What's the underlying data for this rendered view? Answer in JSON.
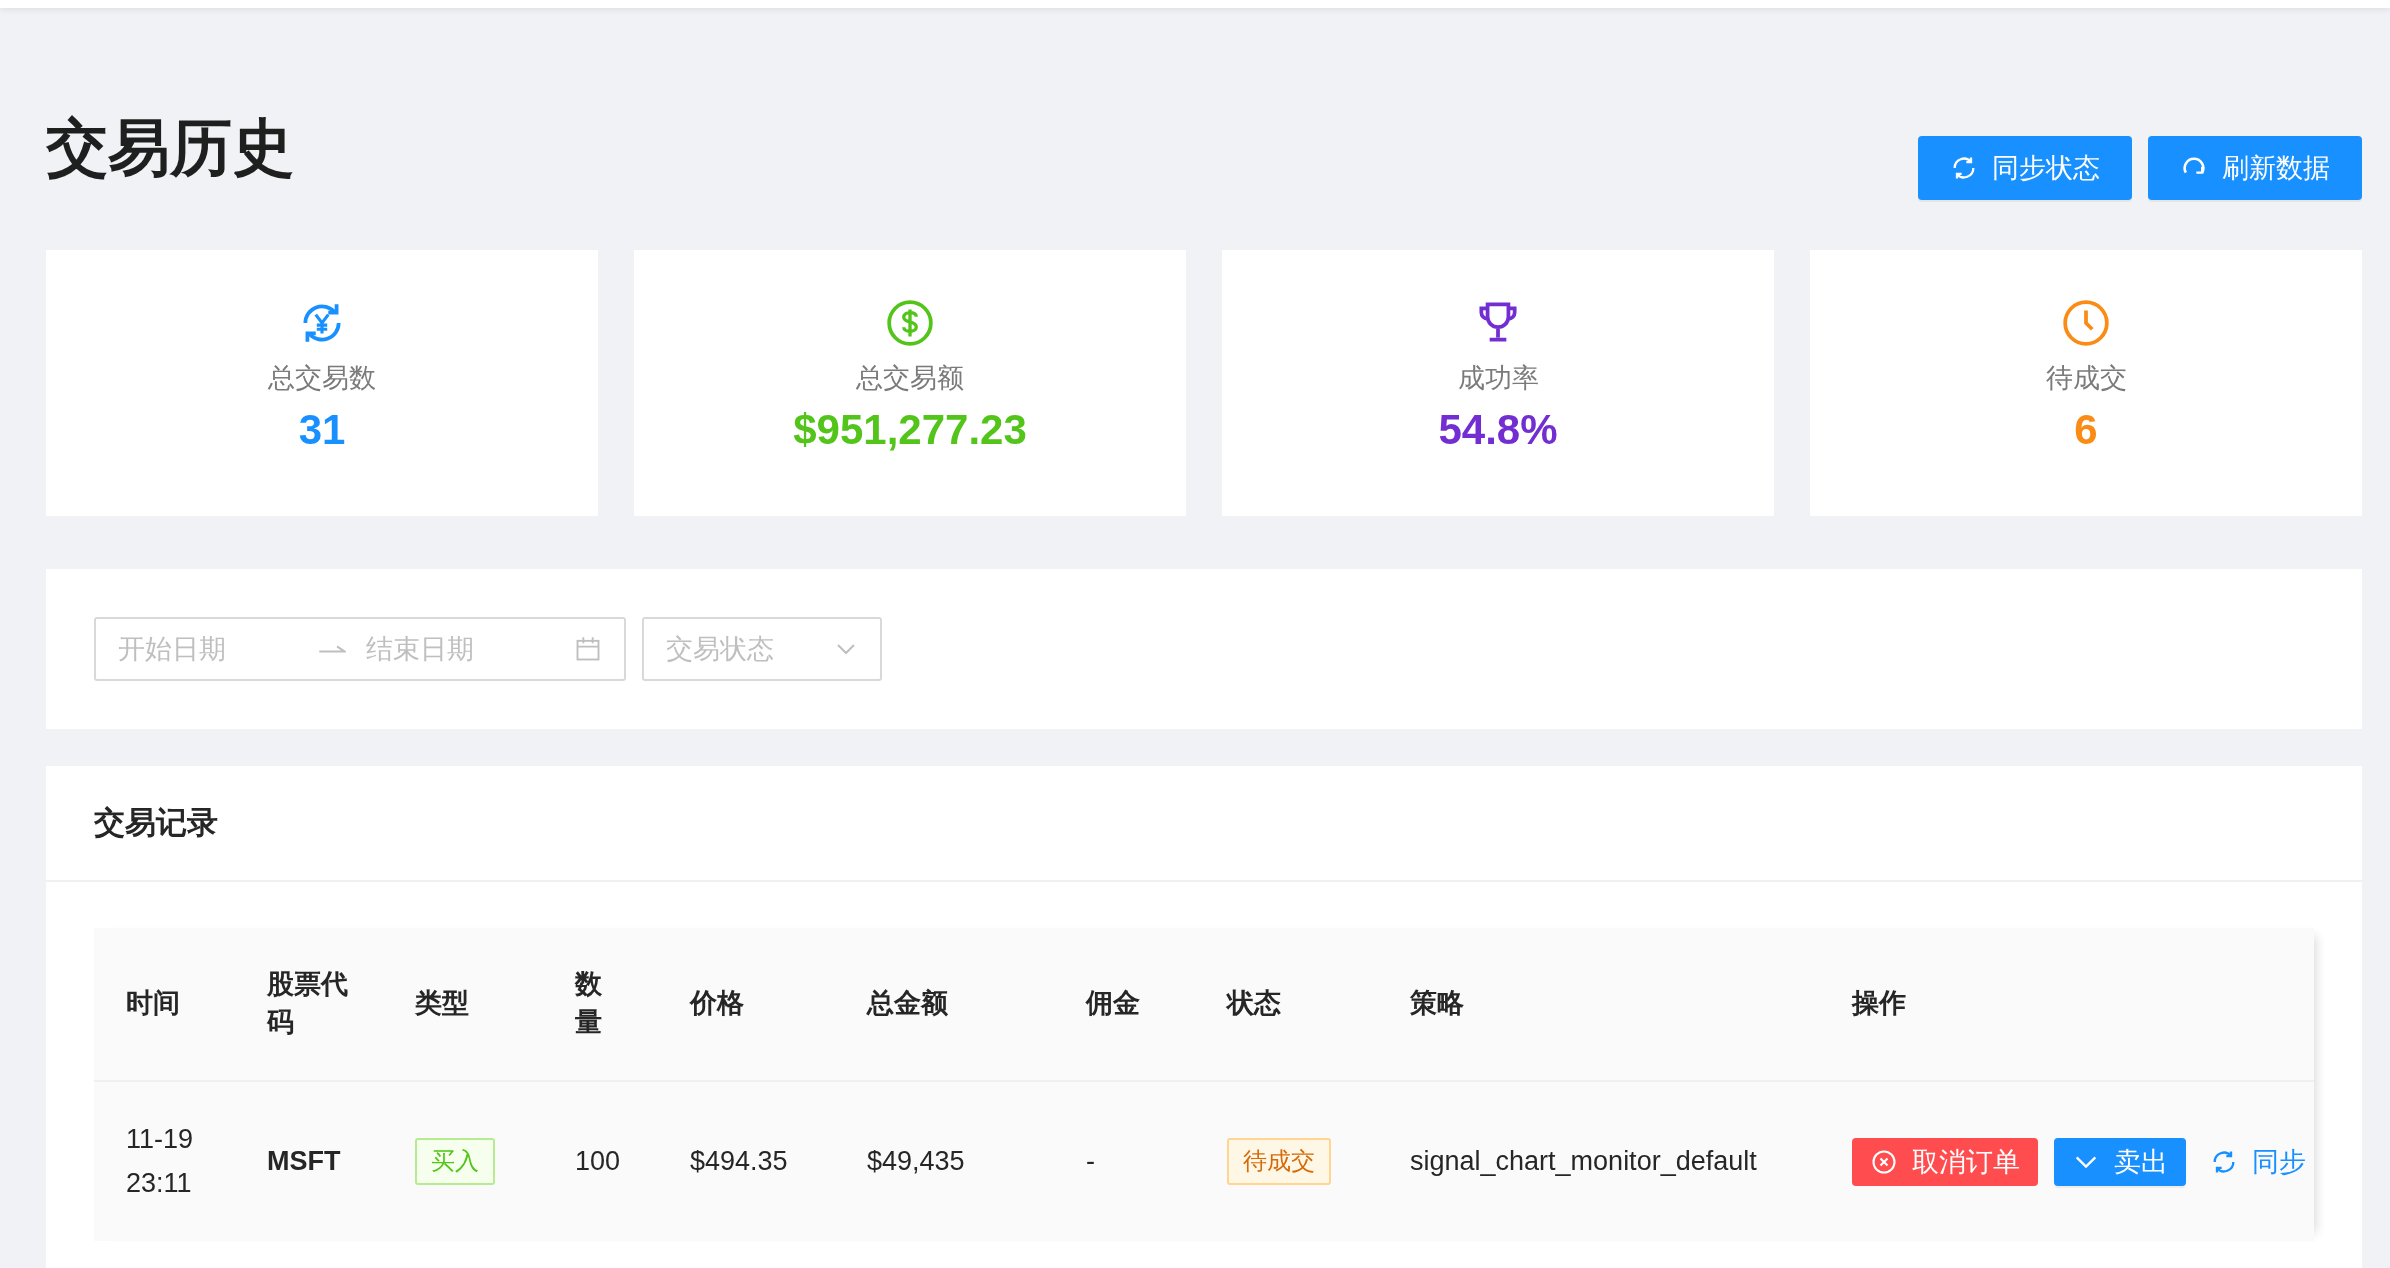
{
  "page": {
    "title": "交易历史"
  },
  "header_buttons": [
    {
      "label": "同步状态",
      "kind": "sync"
    },
    {
      "label": "刷新数据",
      "kind": "refresh"
    }
  ],
  "stats": [
    {
      "label": "总交易数",
      "value": "31",
      "kind": "yen-sync",
      "color": "#1890ff"
    },
    {
      "label": "总交易额",
      "value": "$951,277.23",
      "kind": "dollar",
      "color": "#52c41a"
    },
    {
      "label": "成功率",
      "value": "54.8%",
      "kind": "trophy",
      "color": "#722ed1"
    },
    {
      "label": "待成交",
      "value": "6",
      "kind": "clock",
      "color": "#fa8c16"
    }
  ],
  "filters": {
    "start_date": {
      "placeholder": "开始日期"
    },
    "end_date": {
      "placeholder": "结束日期"
    },
    "status": {
      "placeholder": "交易状态"
    }
  },
  "table": {
    "title": "交易记录",
    "columns": [
      "时间",
      "股票代码",
      "类型",
      "数量",
      "价格",
      "总金额",
      "佣金",
      "状态",
      "策略",
      "操作"
    ],
    "rows": [
      {
        "time": "11-19 23:11",
        "symbol": "MSFT",
        "type": {
          "label": "买入",
          "kind": "buy"
        },
        "quantity": "100",
        "price": "$494.35",
        "total": "$49,435",
        "commission": "-",
        "status": {
          "label": "待成交",
          "kind": "pending"
        },
        "strategy": "signal_chart_monitor_default",
        "actions": [
          {
            "label": "取消订单",
            "kind": "danger"
          },
          {
            "label": "卖出",
            "kind": "primary"
          },
          {
            "label": "同步",
            "kind": "link"
          }
        ]
      }
    ]
  }
}
